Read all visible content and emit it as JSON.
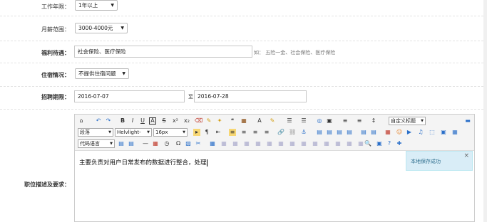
{
  "form": {
    "work_years": {
      "label": "工作年限：",
      "value": "1年以上"
    },
    "salary": {
      "label": "月薪范围：",
      "value": "3000-4000元"
    },
    "benefits": {
      "label": "福利待遇：",
      "value": "社会保险、医疗保险",
      "hint": "如：  五险一金、社会保险、医疗保险"
    },
    "housing": {
      "label": "住宿情况：",
      "value": "不提供住宿问题"
    },
    "recruit_period": {
      "label": "招聘期限：",
      "start": "2016-07-07",
      "sep": "至",
      "end": "2016-07-28"
    },
    "job_desc": {
      "label": "职位描述及要求："
    }
  },
  "editor": {
    "paragraph_select": "段落",
    "font_select": "Helvlight-",
    "size_select": "16px",
    "code_select": "代码语言",
    "custom_heading": "自定义标题",
    "content": "主要负责对用户日常发布的数据进行整合，处理"
  },
  "toast": {
    "message": "本地保存成功",
    "close": "×"
  },
  "icons": {
    "row1": [
      "⌂",
      "↶",
      "↷",
      "B",
      "I",
      "U",
      "A",
      "S",
      "x²",
      "x₂",
      "⌫",
      "✎",
      "✦",
      "❝",
      "▦",
      "A",
      "✎",
      "☰",
      "☰",
      "◎",
      "▣",
      "≡",
      "≡",
      "↕"
    ],
    "row2": [
      "▸",
      "¶",
      "⇤",
      "≡",
      "≡",
      "≡",
      "≡",
      "🔗",
      "⛓",
      "⚓",
      "▤",
      "▤",
      "▤",
      "▤",
      "▤",
      "▤",
      "▦",
      "☺",
      "▶",
      "♫",
      "⬚",
      "▣",
      "▦"
    ],
    "row3": [
      "▤",
      "▤",
      "—",
      "▦",
      "◷",
      "Ω",
      "▧",
      "✂",
      "▦",
      "▦",
      "▦",
      "▦",
      "▦",
      "▦",
      "▦",
      "▦",
      "▦",
      "▦",
      "▦",
      "▦",
      "▦",
      "▦",
      "🔍",
      "▣",
      "?",
      "✚"
    ]
  }
}
